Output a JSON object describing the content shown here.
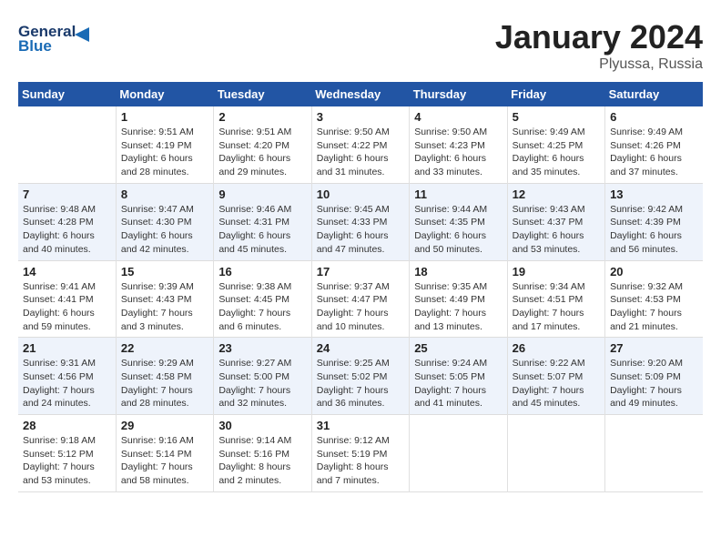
{
  "header": {
    "logo_line1": "General",
    "logo_line2": "Blue",
    "month": "January 2024",
    "location": "Plyussa, Russia"
  },
  "columns": [
    "Sunday",
    "Monday",
    "Tuesday",
    "Wednesday",
    "Thursday",
    "Friday",
    "Saturday"
  ],
  "weeks": [
    {
      "days": [
        {
          "num": "",
          "sunrise": "",
          "sunset": "",
          "daylight": ""
        },
        {
          "num": "1",
          "sunrise": "Sunrise: 9:51 AM",
          "sunset": "Sunset: 4:19 PM",
          "daylight": "Daylight: 6 hours and 28 minutes."
        },
        {
          "num": "2",
          "sunrise": "Sunrise: 9:51 AM",
          "sunset": "Sunset: 4:20 PM",
          "daylight": "Daylight: 6 hours and 29 minutes."
        },
        {
          "num": "3",
          "sunrise": "Sunrise: 9:50 AM",
          "sunset": "Sunset: 4:22 PM",
          "daylight": "Daylight: 6 hours and 31 minutes."
        },
        {
          "num": "4",
          "sunrise": "Sunrise: 9:50 AM",
          "sunset": "Sunset: 4:23 PM",
          "daylight": "Daylight: 6 hours and 33 minutes."
        },
        {
          "num": "5",
          "sunrise": "Sunrise: 9:49 AM",
          "sunset": "Sunset: 4:25 PM",
          "daylight": "Daylight: 6 hours and 35 minutes."
        },
        {
          "num": "6",
          "sunrise": "Sunrise: 9:49 AM",
          "sunset": "Sunset: 4:26 PM",
          "daylight": "Daylight: 6 hours and 37 minutes."
        }
      ]
    },
    {
      "days": [
        {
          "num": "7",
          "sunrise": "Sunrise: 9:48 AM",
          "sunset": "Sunset: 4:28 PM",
          "daylight": "Daylight: 6 hours and 40 minutes."
        },
        {
          "num": "8",
          "sunrise": "Sunrise: 9:47 AM",
          "sunset": "Sunset: 4:30 PM",
          "daylight": "Daylight: 6 hours and 42 minutes."
        },
        {
          "num": "9",
          "sunrise": "Sunrise: 9:46 AM",
          "sunset": "Sunset: 4:31 PM",
          "daylight": "Daylight: 6 hours and 45 minutes."
        },
        {
          "num": "10",
          "sunrise": "Sunrise: 9:45 AM",
          "sunset": "Sunset: 4:33 PM",
          "daylight": "Daylight: 6 hours and 47 minutes."
        },
        {
          "num": "11",
          "sunrise": "Sunrise: 9:44 AM",
          "sunset": "Sunset: 4:35 PM",
          "daylight": "Daylight: 6 hours and 50 minutes."
        },
        {
          "num": "12",
          "sunrise": "Sunrise: 9:43 AM",
          "sunset": "Sunset: 4:37 PM",
          "daylight": "Daylight: 6 hours and 53 minutes."
        },
        {
          "num": "13",
          "sunrise": "Sunrise: 9:42 AM",
          "sunset": "Sunset: 4:39 PM",
          "daylight": "Daylight: 6 hours and 56 minutes."
        }
      ]
    },
    {
      "days": [
        {
          "num": "14",
          "sunrise": "Sunrise: 9:41 AM",
          "sunset": "Sunset: 4:41 PM",
          "daylight": "Daylight: 6 hours and 59 minutes."
        },
        {
          "num": "15",
          "sunrise": "Sunrise: 9:39 AM",
          "sunset": "Sunset: 4:43 PM",
          "daylight": "Daylight: 7 hours and 3 minutes."
        },
        {
          "num": "16",
          "sunrise": "Sunrise: 9:38 AM",
          "sunset": "Sunset: 4:45 PM",
          "daylight": "Daylight: 7 hours and 6 minutes."
        },
        {
          "num": "17",
          "sunrise": "Sunrise: 9:37 AM",
          "sunset": "Sunset: 4:47 PM",
          "daylight": "Daylight: 7 hours and 10 minutes."
        },
        {
          "num": "18",
          "sunrise": "Sunrise: 9:35 AM",
          "sunset": "Sunset: 4:49 PM",
          "daylight": "Daylight: 7 hours and 13 minutes."
        },
        {
          "num": "19",
          "sunrise": "Sunrise: 9:34 AM",
          "sunset": "Sunset: 4:51 PM",
          "daylight": "Daylight: 7 hours and 17 minutes."
        },
        {
          "num": "20",
          "sunrise": "Sunrise: 9:32 AM",
          "sunset": "Sunset: 4:53 PM",
          "daylight": "Daylight: 7 hours and 21 minutes."
        }
      ]
    },
    {
      "days": [
        {
          "num": "21",
          "sunrise": "Sunrise: 9:31 AM",
          "sunset": "Sunset: 4:56 PM",
          "daylight": "Daylight: 7 hours and 24 minutes."
        },
        {
          "num": "22",
          "sunrise": "Sunrise: 9:29 AM",
          "sunset": "Sunset: 4:58 PM",
          "daylight": "Daylight: 7 hours and 28 minutes."
        },
        {
          "num": "23",
          "sunrise": "Sunrise: 9:27 AM",
          "sunset": "Sunset: 5:00 PM",
          "daylight": "Daylight: 7 hours and 32 minutes."
        },
        {
          "num": "24",
          "sunrise": "Sunrise: 9:25 AM",
          "sunset": "Sunset: 5:02 PM",
          "daylight": "Daylight: 7 hours and 36 minutes."
        },
        {
          "num": "25",
          "sunrise": "Sunrise: 9:24 AM",
          "sunset": "Sunset: 5:05 PM",
          "daylight": "Daylight: 7 hours and 41 minutes."
        },
        {
          "num": "26",
          "sunrise": "Sunrise: 9:22 AM",
          "sunset": "Sunset: 5:07 PM",
          "daylight": "Daylight: 7 hours and 45 minutes."
        },
        {
          "num": "27",
          "sunrise": "Sunrise: 9:20 AM",
          "sunset": "Sunset: 5:09 PM",
          "daylight": "Daylight: 7 hours and 49 minutes."
        }
      ]
    },
    {
      "days": [
        {
          "num": "28",
          "sunrise": "Sunrise: 9:18 AM",
          "sunset": "Sunset: 5:12 PM",
          "daylight": "Daylight: 7 hours and 53 minutes."
        },
        {
          "num": "29",
          "sunrise": "Sunrise: 9:16 AM",
          "sunset": "Sunset: 5:14 PM",
          "daylight": "Daylight: 7 hours and 58 minutes."
        },
        {
          "num": "30",
          "sunrise": "Sunrise: 9:14 AM",
          "sunset": "Sunset: 5:16 PM",
          "daylight": "Daylight: 8 hours and 2 minutes."
        },
        {
          "num": "31",
          "sunrise": "Sunrise: 9:12 AM",
          "sunset": "Sunset: 5:19 PM",
          "daylight": "Daylight: 8 hours and 7 minutes."
        },
        {
          "num": "",
          "sunrise": "",
          "sunset": "",
          "daylight": ""
        },
        {
          "num": "",
          "sunrise": "",
          "sunset": "",
          "daylight": ""
        },
        {
          "num": "",
          "sunrise": "",
          "sunset": "",
          "daylight": ""
        }
      ]
    }
  ]
}
